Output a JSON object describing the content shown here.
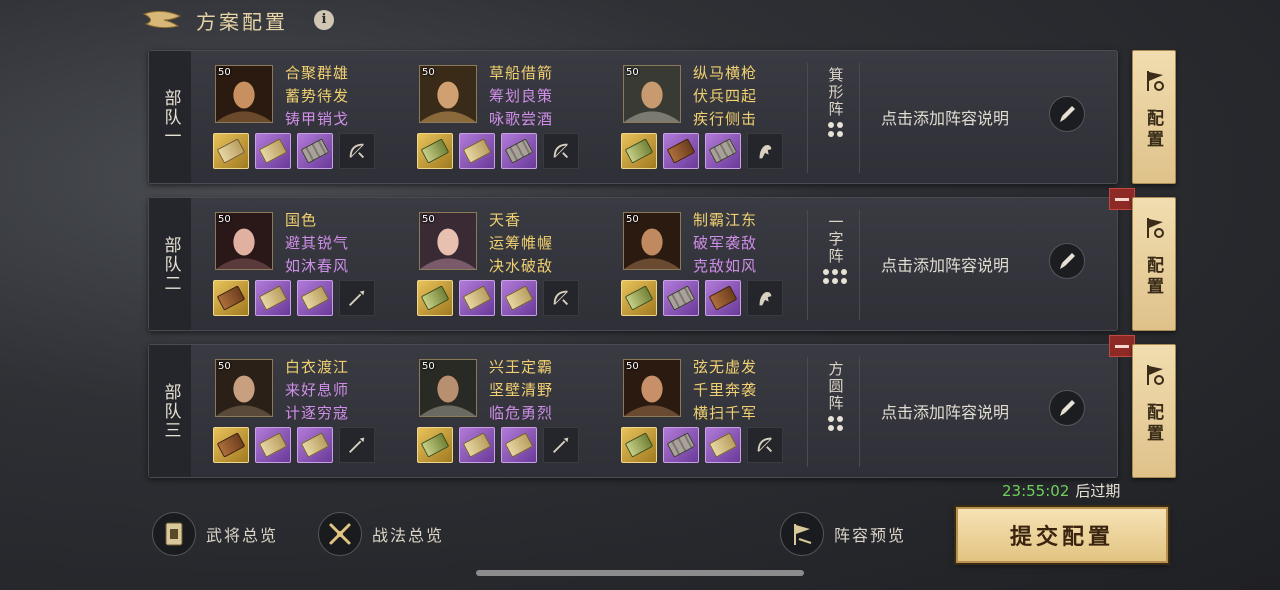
{
  "header": {
    "title": "方案配置",
    "info": "i"
  },
  "squads": [
    {
      "label": "部队一",
      "generals": [
        {
          "level": "50",
          "skills": [
            "合聚群雄",
            "蓄势待发",
            "铸甲销戈"
          ],
          "skill_colors": [
            "gold",
            "gold",
            "purple"
          ],
          "items": [
            [
              "gold",
              "tan"
            ],
            [
              "purple",
              "tan"
            ],
            [
              "purple",
              "grey"
            ]
          ],
          "weapon": "bow-icon"
        },
        {
          "level": "50",
          "skills": [
            "草船借箭",
            "筹划良策",
            "咏歌尝酒"
          ],
          "skill_colors": [
            "gold",
            "purple",
            "purple"
          ],
          "items": [
            [
              "gold",
              "green"
            ],
            [
              "purple",
              "tan"
            ],
            [
              "purple",
              "grey"
            ]
          ],
          "weapon": "bow-icon"
        },
        {
          "level": "50",
          "skills": [
            "纵马横枪",
            "伏兵四起",
            "疾行侧击"
          ],
          "skill_colors": [
            "gold",
            "gold",
            "gold"
          ],
          "items": [
            [
              "gold",
              "green"
            ],
            [
              "purple",
              "brown"
            ],
            [
              "purple",
              "grey"
            ]
          ],
          "weapon": "horse-icon"
        }
      ],
      "formation": {
        "name": "箕形阵",
        "dots": 4
      },
      "description": "点击添加阵容说明",
      "removable": false
    },
    {
      "label": "部队二",
      "generals": [
        {
          "level": "50",
          "skills": [
            "国色",
            "避其锐气",
            "如沐春风"
          ],
          "skill_colors": [
            "gold",
            "purple",
            "purple"
          ],
          "items": [
            [
              "gold",
              "brown"
            ],
            [
              "purple",
              "tan"
            ],
            [
              "purple",
              "tan"
            ]
          ],
          "weapon": "spear-icon"
        },
        {
          "level": "50",
          "skills": [
            "天香",
            "运筹帷幄",
            "决水破敌"
          ],
          "skill_colors": [
            "gold",
            "gold",
            "gold"
          ],
          "items": [
            [
              "gold",
              "green"
            ],
            [
              "purple",
              "tan"
            ],
            [
              "purple",
              "tan"
            ]
          ],
          "weapon": "bow-icon"
        },
        {
          "level": "50",
          "skills": [
            "制霸江东",
            "破军袭敌",
            "克敌如风"
          ],
          "skill_colors": [
            "gold",
            "purple",
            "purple"
          ],
          "items": [
            [
              "gold",
              "green"
            ],
            [
              "purple",
              "grey"
            ],
            [
              "purple",
              "brown"
            ]
          ],
          "weapon": "horse-icon"
        }
      ],
      "formation": {
        "name": "一字阵",
        "dots": 6
      },
      "description": "点击添加阵容说明",
      "removable": true
    },
    {
      "label": "部队三",
      "generals": [
        {
          "level": "50",
          "skills": [
            "白衣渡江",
            "来好息师",
            "计逐穷寇"
          ],
          "skill_colors": [
            "gold",
            "purple",
            "purple"
          ],
          "items": [
            [
              "gold",
              "brown"
            ],
            [
              "purple",
              "tan"
            ],
            [
              "purple",
              "tan"
            ]
          ],
          "weapon": "spear-icon"
        },
        {
          "level": "50",
          "skills": [
            "兴王定霸",
            "坚壁清野",
            "临危勇烈"
          ],
          "skill_colors": [
            "gold",
            "gold",
            "purple"
          ],
          "items": [
            [
              "gold",
              "green"
            ],
            [
              "purple",
              "tan"
            ],
            [
              "purple",
              "tan"
            ]
          ],
          "weapon": "spear-icon"
        },
        {
          "level": "50",
          "skills": [
            "弦无虚发",
            "千里奔袭",
            "横扫千军"
          ],
          "skill_colors": [
            "gold",
            "gold",
            "gold"
          ],
          "items": [
            [
              "gold",
              "green"
            ],
            [
              "purple",
              "grey"
            ],
            [
              "purple",
              "tan"
            ]
          ],
          "weapon": "bow-icon"
        }
      ],
      "formation": {
        "name": "方圆阵",
        "dots": 4
      },
      "description": "点击添加阵容说明",
      "removable": true
    }
  ],
  "config_label": "配置",
  "expire": {
    "time": "23:55:02",
    "suffix": "后过期"
  },
  "bottom": {
    "generals_overview": "武将总览",
    "tactics_overview": "战法总览",
    "lineup_preview": "阵容预览",
    "submit": "提交配置"
  },
  "colors": {
    "gold_text": "#f0d070",
    "purple_text": "#cf8ee8",
    "timer": "#6fd05a",
    "remove": "#8e2a26"
  }
}
